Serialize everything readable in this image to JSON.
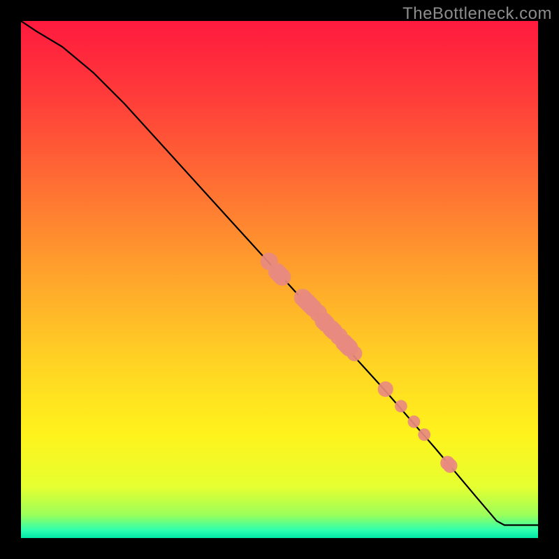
{
  "watermark": "TheBottleneck.com",
  "chart_data": {
    "type": "line",
    "title": "",
    "xlabel": "",
    "ylabel": "",
    "xlim": [
      0,
      100
    ],
    "ylim": [
      0,
      100
    ],
    "background_gradient": {
      "stops": [
        {
          "pos": 0.0,
          "color": "#ff1a3e"
        },
        {
          "pos": 0.14,
          "color": "#ff3a3a"
        },
        {
          "pos": 0.3,
          "color": "#ff6a34"
        },
        {
          "pos": 0.48,
          "color": "#ffa02c"
        },
        {
          "pos": 0.66,
          "color": "#ffd324"
        },
        {
          "pos": 0.8,
          "color": "#fff31c"
        },
        {
          "pos": 0.9,
          "color": "#e6ff30"
        },
        {
          "pos": 0.955,
          "color": "#9cff5a"
        },
        {
          "pos": 0.985,
          "color": "#2dffb0"
        },
        {
          "pos": 1.0,
          "color": "#00e6a8"
        }
      ]
    },
    "series": [
      {
        "name": "curve",
        "type": "line",
        "color": "#000000",
        "points": [
          {
            "x": 0,
            "y": 100
          },
          {
            "x": 3,
            "y": 98
          },
          {
            "x": 8,
            "y": 95
          },
          {
            "x": 14,
            "y": 90
          },
          {
            "x": 20,
            "y": 84
          },
          {
            "x": 30,
            "y": 73
          },
          {
            "x": 40,
            "y": 62
          },
          {
            "x": 50,
            "y": 51
          },
          {
            "x": 60,
            "y": 40
          },
          {
            "x": 70,
            "y": 29
          },
          {
            "x": 80,
            "y": 17.5
          },
          {
            "x": 88,
            "y": 8
          },
          {
            "x": 92,
            "y": 3.3
          },
          {
            "x": 93.5,
            "y": 2.5
          },
          {
            "x": 100,
            "y": 2.5
          }
        ]
      },
      {
        "name": "markers",
        "type": "scatter",
        "color": "#e88a80",
        "points": [
          {
            "x": 48.0,
            "y": 53.5,
            "r": 1.7
          },
          {
            "x": 49.5,
            "y": 51.5,
            "r": 1.7
          },
          {
            "x": 50.0,
            "y": 51.0,
            "r": 1.7
          },
          {
            "x": 50.5,
            "y": 50.5,
            "r": 1.7
          },
          {
            "x": 54.5,
            "y": 46.5,
            "r": 1.7
          },
          {
            "x": 55.0,
            "y": 46.0,
            "r": 1.7
          },
          {
            "x": 55.5,
            "y": 45.5,
            "r": 1.7
          },
          {
            "x": 56.0,
            "y": 45.0,
            "r": 1.7
          },
          {
            "x": 56.5,
            "y": 44.5,
            "r": 1.7
          },
          {
            "x": 57.5,
            "y": 43.5,
            "r": 1.7
          },
          {
            "x": 58.5,
            "y": 42.0,
            "r": 1.7
          },
          {
            "x": 59.0,
            "y": 41.5,
            "r": 1.7
          },
          {
            "x": 60.0,
            "y": 40.5,
            "r": 1.7
          },
          {
            "x": 60.5,
            "y": 40.0,
            "r": 1.7
          },
          {
            "x": 61.5,
            "y": 39.0,
            "r": 1.7
          },
          {
            "x": 62.5,
            "y": 37.8,
            "r": 1.7
          },
          {
            "x": 63.0,
            "y": 37.3,
            "r": 1.7
          },
          {
            "x": 63.5,
            "y": 36.8,
            "r": 1.7
          },
          {
            "x": 64.5,
            "y": 35.7,
            "r": 1.5
          },
          {
            "x": 70.5,
            "y": 28.8,
            "r": 1.5
          },
          {
            "x": 73.5,
            "y": 25.5,
            "r": 1.2
          },
          {
            "x": 76.0,
            "y": 22.5,
            "r": 1.2
          },
          {
            "x": 78.0,
            "y": 20.0,
            "r": 1.2
          },
          {
            "x": 82.5,
            "y": 14.5,
            "r": 1.4
          },
          {
            "x": 83.0,
            "y": 14.0,
            "r": 1.4
          }
        ]
      }
    ]
  }
}
